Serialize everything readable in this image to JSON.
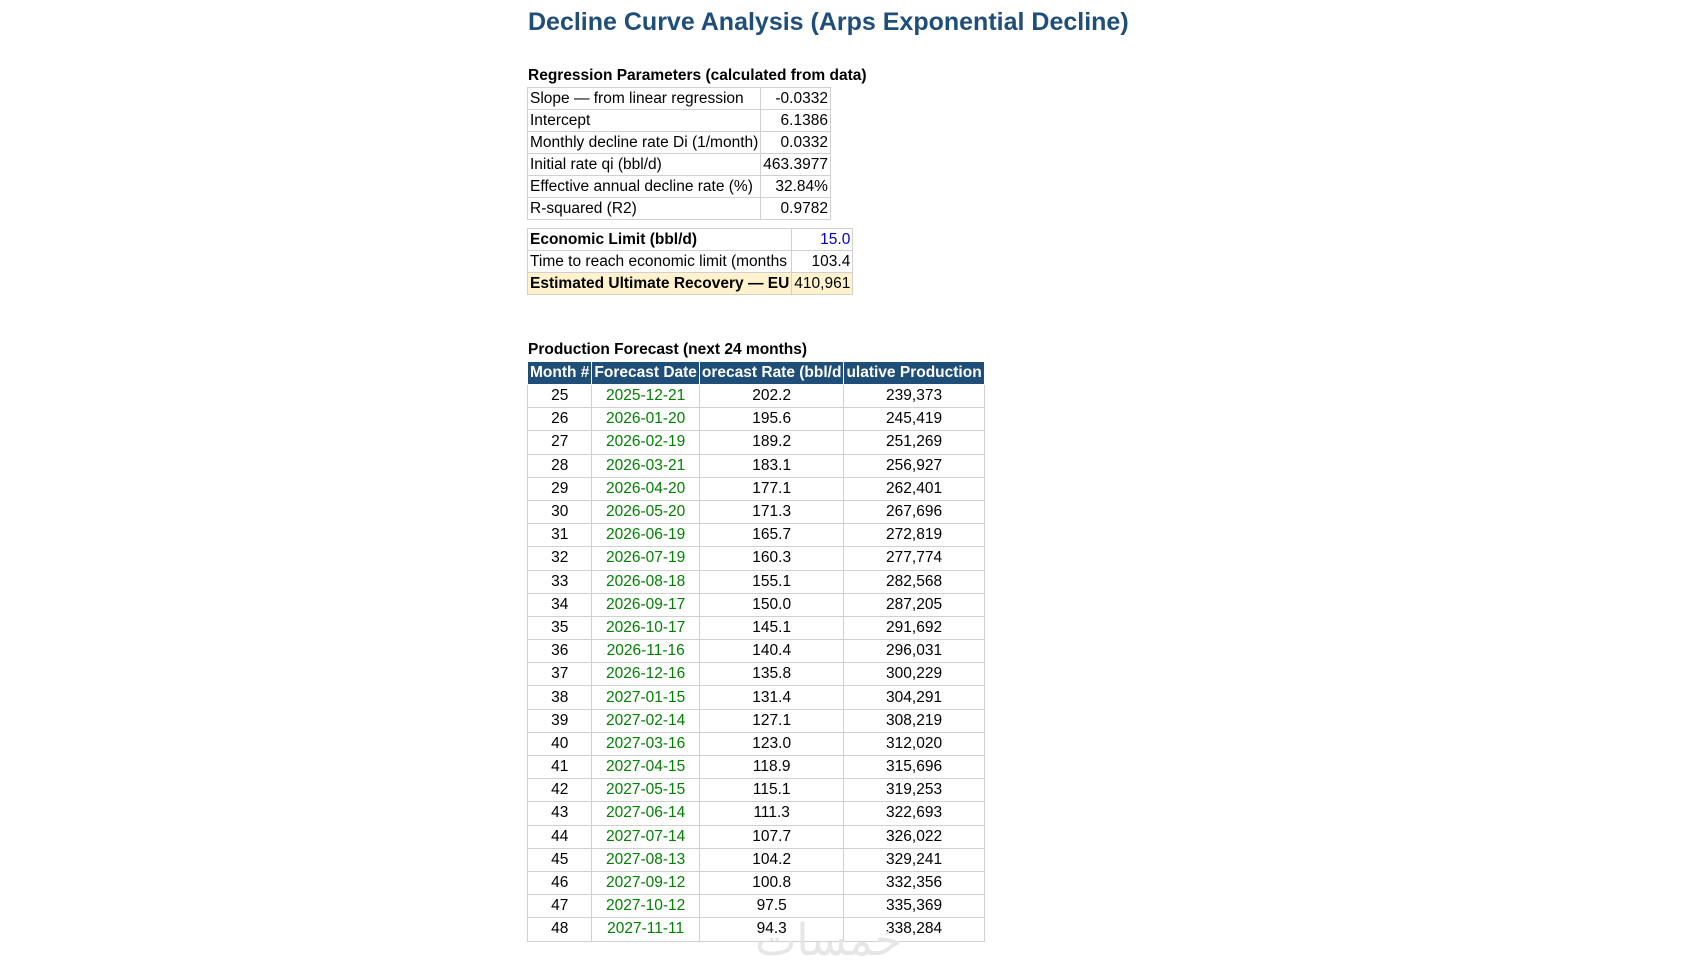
{
  "title": "Decline Curve Analysis (Arps Exponential Decline)",
  "regression": {
    "heading": "Regression Parameters (calculated from data)",
    "rows": [
      {
        "label": "Slope — from linear regression",
        "value": "-0.0332"
      },
      {
        "label": "Intercept",
        "value": "6.1386"
      },
      {
        "label": "Monthly decline rate Di (1/month)",
        "value": "0.0332"
      },
      {
        "label": "Initial rate qi (bbl/d)",
        "value": "463.3977"
      },
      {
        "label": "Effective annual decline rate (%)",
        "value": "32.84%"
      },
      {
        "label": "R-squared (R2)",
        "value": "0.9782"
      }
    ]
  },
  "economics": {
    "economic_limit_label": "Economic Limit (bbl/d)",
    "economic_limit_value": "15.0",
    "time_label": "Time to reach economic limit (months",
    "time_value": "103.4",
    "eur_label": "Estimated Ultimate Recovery — EU",
    "eur_value": "410,961"
  },
  "forecast": {
    "heading": "Production Forecast (next 24 months)",
    "columns": [
      "Month #",
      "Forecast Date",
      "orecast Rate (bbl/d",
      "ulative Production"
    ],
    "rows": [
      [
        "25",
        "2025-12-21",
        "202.2",
        "239,373"
      ],
      [
        "26",
        "2026-01-20",
        "195.6",
        "245,419"
      ],
      [
        "27",
        "2026-02-19",
        "189.2",
        "251,269"
      ],
      [
        "28",
        "2026-03-21",
        "183.1",
        "256,927"
      ],
      [
        "29",
        "2026-04-20",
        "177.1",
        "262,401"
      ],
      [
        "30",
        "2026-05-20",
        "171.3",
        "267,696"
      ],
      [
        "31",
        "2026-06-19",
        "165.7",
        "272,819"
      ],
      [
        "32",
        "2026-07-19",
        "160.3",
        "277,774"
      ],
      [
        "33",
        "2026-08-18",
        "155.1",
        "282,568"
      ],
      [
        "34",
        "2026-09-17",
        "150.0",
        "287,205"
      ],
      [
        "35",
        "2026-10-17",
        "145.1",
        "291,692"
      ],
      [
        "36",
        "2026-11-16",
        "140.4",
        "296,031"
      ],
      [
        "37",
        "2026-12-16",
        "135.8",
        "300,229"
      ],
      [
        "38",
        "2027-01-15",
        "131.4",
        "304,291"
      ],
      [
        "39",
        "2027-02-14",
        "127.1",
        "308,219"
      ],
      [
        "40",
        "2027-03-16",
        "123.0",
        "312,020"
      ],
      [
        "41",
        "2027-04-15",
        "118.9",
        "315,696"
      ],
      [
        "42",
        "2027-05-15",
        "115.1",
        "319,253"
      ],
      [
        "43",
        "2027-06-14",
        "111.3",
        "322,693"
      ],
      [
        "44",
        "2027-07-14",
        "107.7",
        "326,022"
      ],
      [
        "45",
        "2027-08-13",
        "104.2",
        "329,241"
      ],
      [
        "46",
        "2027-09-12",
        "100.8",
        "332,356"
      ],
      [
        "47",
        "2027-10-12",
        "97.5",
        "335,369"
      ],
      [
        "48",
        "2027-11-11",
        "94.3",
        "338,284"
      ]
    ]
  },
  "colors": {
    "title": "#1f4e79",
    "header_bg": "#1f4e79",
    "date_text": "#008000",
    "input_value": "#0000cc",
    "highlight": "#fff2cc"
  }
}
